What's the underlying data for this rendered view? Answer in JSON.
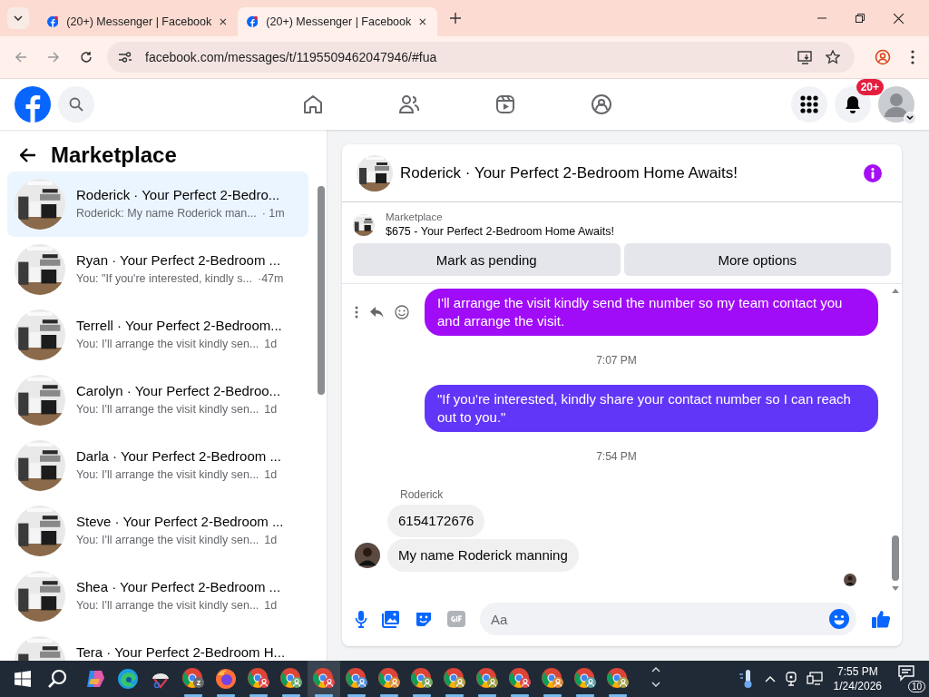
{
  "browser": {
    "tabs": [
      {
        "title": "(20+) Messenger | Facebook",
        "selected": false
      },
      {
        "title": "(20+) Messenger | Facebook",
        "selected": true
      }
    ],
    "url": "facebook.com/messages/t/1195509462047946/#fua"
  },
  "header": {
    "notification_badge": "20+",
    "nav": [
      {
        "kind": "home"
      },
      {
        "kind": "friends"
      },
      {
        "kind": "video"
      },
      {
        "kind": "groups"
      }
    ]
  },
  "sidebar": {
    "title": "Marketplace",
    "conversations": [
      {
        "title": "Roderick · Your Perfect 2-Bedro...",
        "preview": "Roderick: My name Roderick man...",
        "time": "· 1m",
        "selected": true
      },
      {
        "title": "Ryan · Your Perfect 2-Bedroom ...",
        "preview": "You: \"If you're interested, kindly s...",
        "time": "·47m",
        "selected": false
      },
      {
        "title": "Terrell · Your Perfect 2-Bedroom...",
        "preview": "You: I'll arrange the visit kindly sen...",
        "time": "1d",
        "selected": false
      },
      {
        "title": "Carolyn · Your Perfect 2-Bedroo...",
        "preview": "You: I'll arrange the visit kindly sen...",
        "time": "1d",
        "selected": false
      },
      {
        "title": "Darla · Your Perfect 2-Bedroom ...",
        "preview": "You: I'll arrange the visit kindly sen...",
        "time": "1d",
        "selected": false
      },
      {
        "title": "Steve · Your Perfect 2-Bedroom ...",
        "preview": "You: I'll arrange the visit kindly sen...",
        "time": "1d",
        "selected": false
      },
      {
        "title": "Shea · Your Perfect 2-Bedroom ...",
        "preview": "You: I'll arrange the visit kindly sen...",
        "time": "1d",
        "selected": false
      },
      {
        "title": "Tera · Your Perfect 2-Bedroom H...",
        "selected": false
      }
    ]
  },
  "chat": {
    "title": "Roderick · Your Perfect 2-Bedroom Home Awaits!",
    "listing": {
      "label": "Marketplace",
      "title": "$675 - Your Perfect 2-Bedroom Home Awaits!"
    },
    "buttons": [
      "Mark as pending",
      "More options"
    ],
    "messages": [
      {
        "kind": "outgoing",
        "text": "I'll arrange the visit kindly send the number so my team contact you and arrange the visit.",
        "color": "#a00cf8",
        "hovered": true
      },
      {
        "kind": "timestamp",
        "text": "7:07 PM"
      },
      {
        "kind": "outgoing",
        "text": "\"If you're interested, kindly share your contact number so I can reach out to you.\"",
        "color": "#6236f8",
        "hovered": false
      },
      {
        "kind": "timestamp",
        "text": "7:54 PM"
      },
      {
        "kind": "sender",
        "text": "Roderick"
      },
      {
        "kind": "incoming",
        "text": "6154172676",
        "avatar": false
      },
      {
        "kind": "incoming",
        "text": "My name Roderick manning",
        "avatar": true
      }
    ],
    "composer": {
      "placeholder": "Aa"
    }
  },
  "taskbar": {
    "apps": [
      {
        "kind": "copilot",
        "running": false,
        "selected": false
      },
      {
        "kind": "edge",
        "running": false,
        "selected": false
      },
      {
        "kind": "snip",
        "running": false,
        "selected": false
      },
      {
        "kind": "chrome",
        "badge": "z",
        "color": "#6b6b6b",
        "running": true,
        "selected": false
      },
      {
        "kind": "firefox",
        "running": true,
        "selected": false
      },
      {
        "kind": "chrome",
        "color": "#e0474c",
        "running": true,
        "selected": false
      },
      {
        "kind": "chrome",
        "color": "#6ca872",
        "running": true,
        "selected": false
      },
      {
        "kind": "chrome",
        "color": "#e0474c",
        "running": true,
        "selected": true
      },
      {
        "kind": "chrome",
        "color": "#5b8fd4",
        "running": true,
        "selected": false
      },
      {
        "kind": "chrome",
        "color": "#e08a3c",
        "running": true,
        "selected": false
      },
      {
        "kind": "chrome",
        "color": "#7aa65e",
        "running": true,
        "selected": false
      },
      {
        "kind": "chrome",
        "color": "#b8a64a",
        "running": true,
        "selected": false
      },
      {
        "kind": "chrome",
        "color": "#9a9a3e",
        "running": true,
        "selected": false
      },
      {
        "kind": "chrome",
        "color": "#e0474c",
        "running": true,
        "selected": false
      },
      {
        "kind": "chrome",
        "color": "#e08a3c",
        "running": true,
        "selected": false
      },
      {
        "kind": "chrome",
        "color": "#5ea3a8",
        "running": true,
        "selected": false
      },
      {
        "kind": "chrome",
        "color": "#a8a04a",
        "running": true,
        "selected": false
      }
    ],
    "time": "7:55 PM",
    "date": "1/24/2026",
    "notifications": "10"
  }
}
